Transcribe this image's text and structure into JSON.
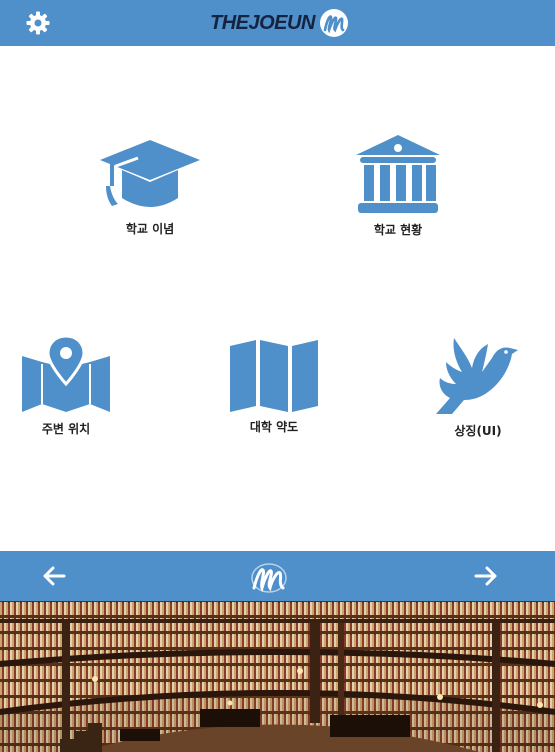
{
  "header": {
    "brand_text": "THEJOEUN",
    "settings_icon": "gear-icon",
    "logo_icon": "brand-script-logo"
  },
  "menu": {
    "items": [
      {
        "label": "학교 이념",
        "icon": "graduation-cap-icon"
      },
      {
        "label": "학교 현황",
        "icon": "institution-building-icon"
      },
      {
        "label": "주변 위치",
        "icon": "map-pin-icon"
      },
      {
        "label": "대학 약도",
        "icon": "folded-map-icon"
      },
      {
        "label": "상징(UI)",
        "icon": "dove-icon"
      }
    ]
  },
  "footer": {
    "prev_icon": "arrow-left-icon",
    "next_icon": "arrow-right-icon",
    "logo_icon": "brand-script-logo"
  },
  "banner": {
    "image": "library-interior-photo"
  },
  "colors": {
    "primary": "#4f8fca",
    "brand_text": "#14233f",
    "label": "#222222"
  }
}
